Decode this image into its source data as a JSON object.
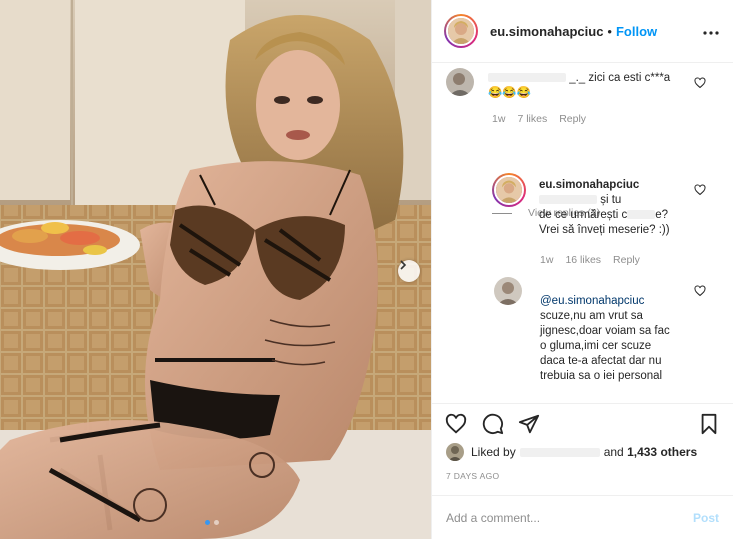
{
  "post": {
    "username": "eu.simonahapciuc",
    "separator": "•",
    "follow_label": "Follow",
    "more_label": "•••"
  },
  "media": {
    "carousel_dots": 2,
    "active_dot": 0,
    "next_icon": "chevron-right-icon"
  },
  "comments": [
    {
      "text": "_._ zici ca esti c***a",
      "emoji": "😂😂😂",
      "time": "1w",
      "likes": "7 likes",
      "reply_label": "Reply"
    }
  ],
  "view_replies": "View replies (2)",
  "replies": [
    {
      "username": "eu.simonahapciuc",
      "line1": "și tu",
      "line2": "de ce urmărești c",
      "line2_end": "e?",
      "line3": "Vrei să înveți meserie? :))",
      "time": "1w",
      "likes": "16 likes",
      "reply_label": "Reply"
    },
    {
      "mention": "@eu.simonahapciuc",
      "lines": [
        "scuze,nu am vrut sa",
        "jignesc,doar voiam sa fac",
        "o gluma,imi cer scuze",
        "daca te-a afectat dar nu",
        "trebuia sa o iei personal"
      ]
    }
  ],
  "likes": {
    "prefix": "Liked by",
    "suffix_and": "and",
    "others": "1,433 others"
  },
  "date": "7 DAYS AGO",
  "add_comment": {
    "placeholder": "Add a comment...",
    "post_label": "Post"
  },
  "colors": {
    "accent": "#0095f6",
    "post_disabled": "#b2dffc",
    "muted": "#8e8e8e"
  },
  "icons": {
    "like": "heart-icon",
    "comment": "comment-icon",
    "share": "paper-plane-icon",
    "save": "bookmark-icon",
    "more": "more-horizontal-icon"
  }
}
